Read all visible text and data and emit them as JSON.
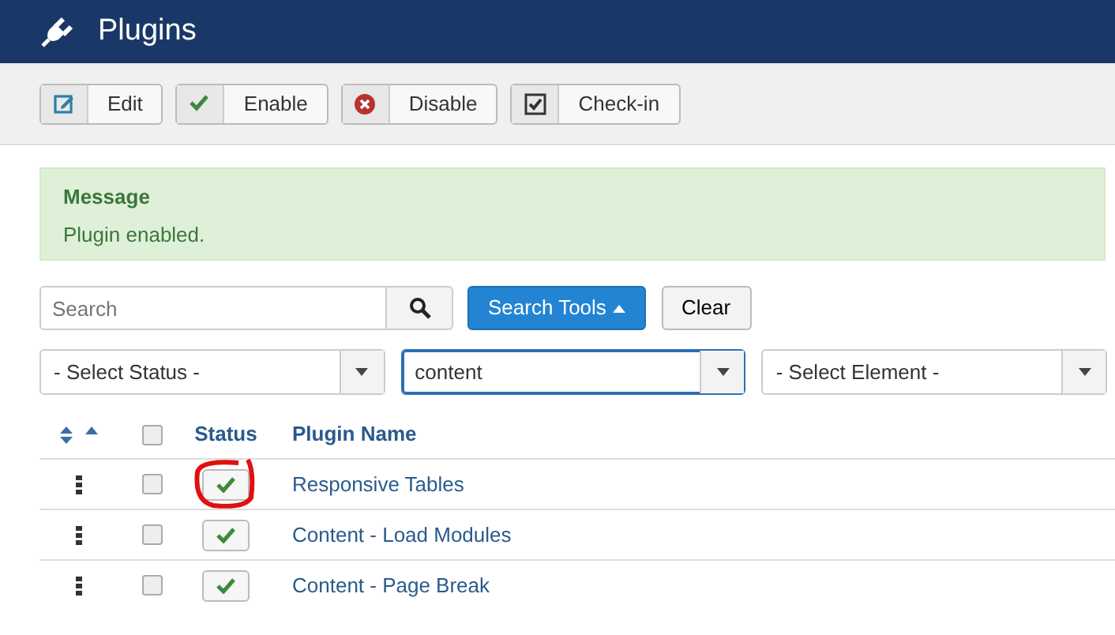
{
  "header": {
    "title": "Plugins"
  },
  "toolbar": [
    {
      "kind": "edit",
      "label": "Edit"
    },
    {
      "kind": "enable",
      "label": "Enable"
    },
    {
      "kind": "disable",
      "label": "Disable"
    },
    {
      "kind": "checkin",
      "label": "Check-in"
    }
  ],
  "message": {
    "heading": "Message",
    "text": "Plugin enabled."
  },
  "search": {
    "placeholder": "Search",
    "tools_label": "Search Tools",
    "clear_label": "Clear"
  },
  "filters": [
    {
      "value": "- Select Status -",
      "focused": false
    },
    {
      "value": "content",
      "focused": true
    },
    {
      "value": "- Select Element -",
      "focused": false
    }
  ],
  "table": {
    "columns": [
      "Status",
      "Plugin Name"
    ],
    "select_all_checked": false,
    "rows": [
      {
        "name": "Responsive Tables",
        "checked": false,
        "enabled": true,
        "highlighted": true
      },
      {
        "name": "Content - Load Modules",
        "checked": false,
        "enabled": true,
        "highlighted": false
      },
      {
        "name": "Content - Page Break",
        "checked": false,
        "enabled": true,
        "highlighted": false
      }
    ]
  }
}
